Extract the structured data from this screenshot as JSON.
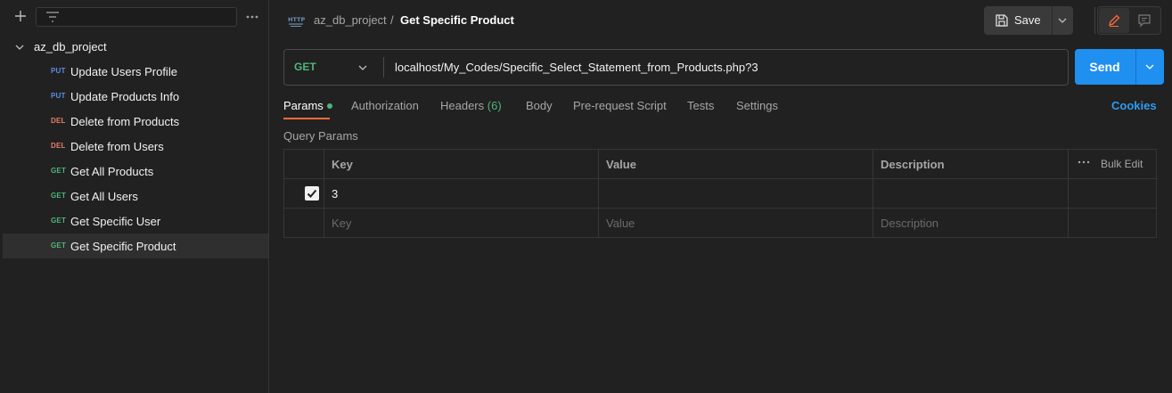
{
  "sidebar": {
    "filter_placeholder": "",
    "collection": {
      "name": "az_db_project"
    },
    "items": [
      {
        "method": "PUT",
        "label": "Update Users Profile"
      },
      {
        "method": "PUT",
        "label": "Update Products Info"
      },
      {
        "method": "DEL",
        "label": "Delete from Products"
      },
      {
        "method": "DEL",
        "label": "Delete from Users"
      },
      {
        "method": "GET",
        "label": "Get All Products"
      },
      {
        "method": "GET",
        "label": "Get All Users"
      },
      {
        "method": "GET",
        "label": "Get Specific User"
      },
      {
        "method": "GET",
        "label": "Get Specific Product"
      }
    ]
  },
  "header": {
    "breadcrumb_parent": "az_db_project",
    "breadcrumb_separator": "/",
    "title": "Get Specific Product",
    "save_label": "Save"
  },
  "request": {
    "method": "GET",
    "url": "localhost/My_Codes/Specific_Select_Statement_from_Products.php?3",
    "send_label": "Send"
  },
  "tabs": {
    "params": "Params",
    "authorization": "Authorization",
    "headers": "Headers",
    "headers_count": "(6)",
    "body": "Body",
    "prerequest": "Pre-request Script",
    "tests": "Tests",
    "settings": "Settings",
    "cookies": "Cookies"
  },
  "query_params": {
    "title": "Query Params",
    "columns": {
      "key": "Key",
      "value": "Value",
      "description": "Description",
      "bulk_edit": "Bulk Edit"
    },
    "rows": [
      {
        "checked": true,
        "key": "3",
        "value": "",
        "description": ""
      }
    ],
    "placeholders": {
      "key": "Key",
      "value": "Value",
      "description": "Description"
    }
  },
  "colors": {
    "accent": "#ff6c37",
    "send": "#1f8ff0",
    "get": "#4fb57a",
    "put": "#5a8fe6",
    "del": "#e67d6b"
  }
}
